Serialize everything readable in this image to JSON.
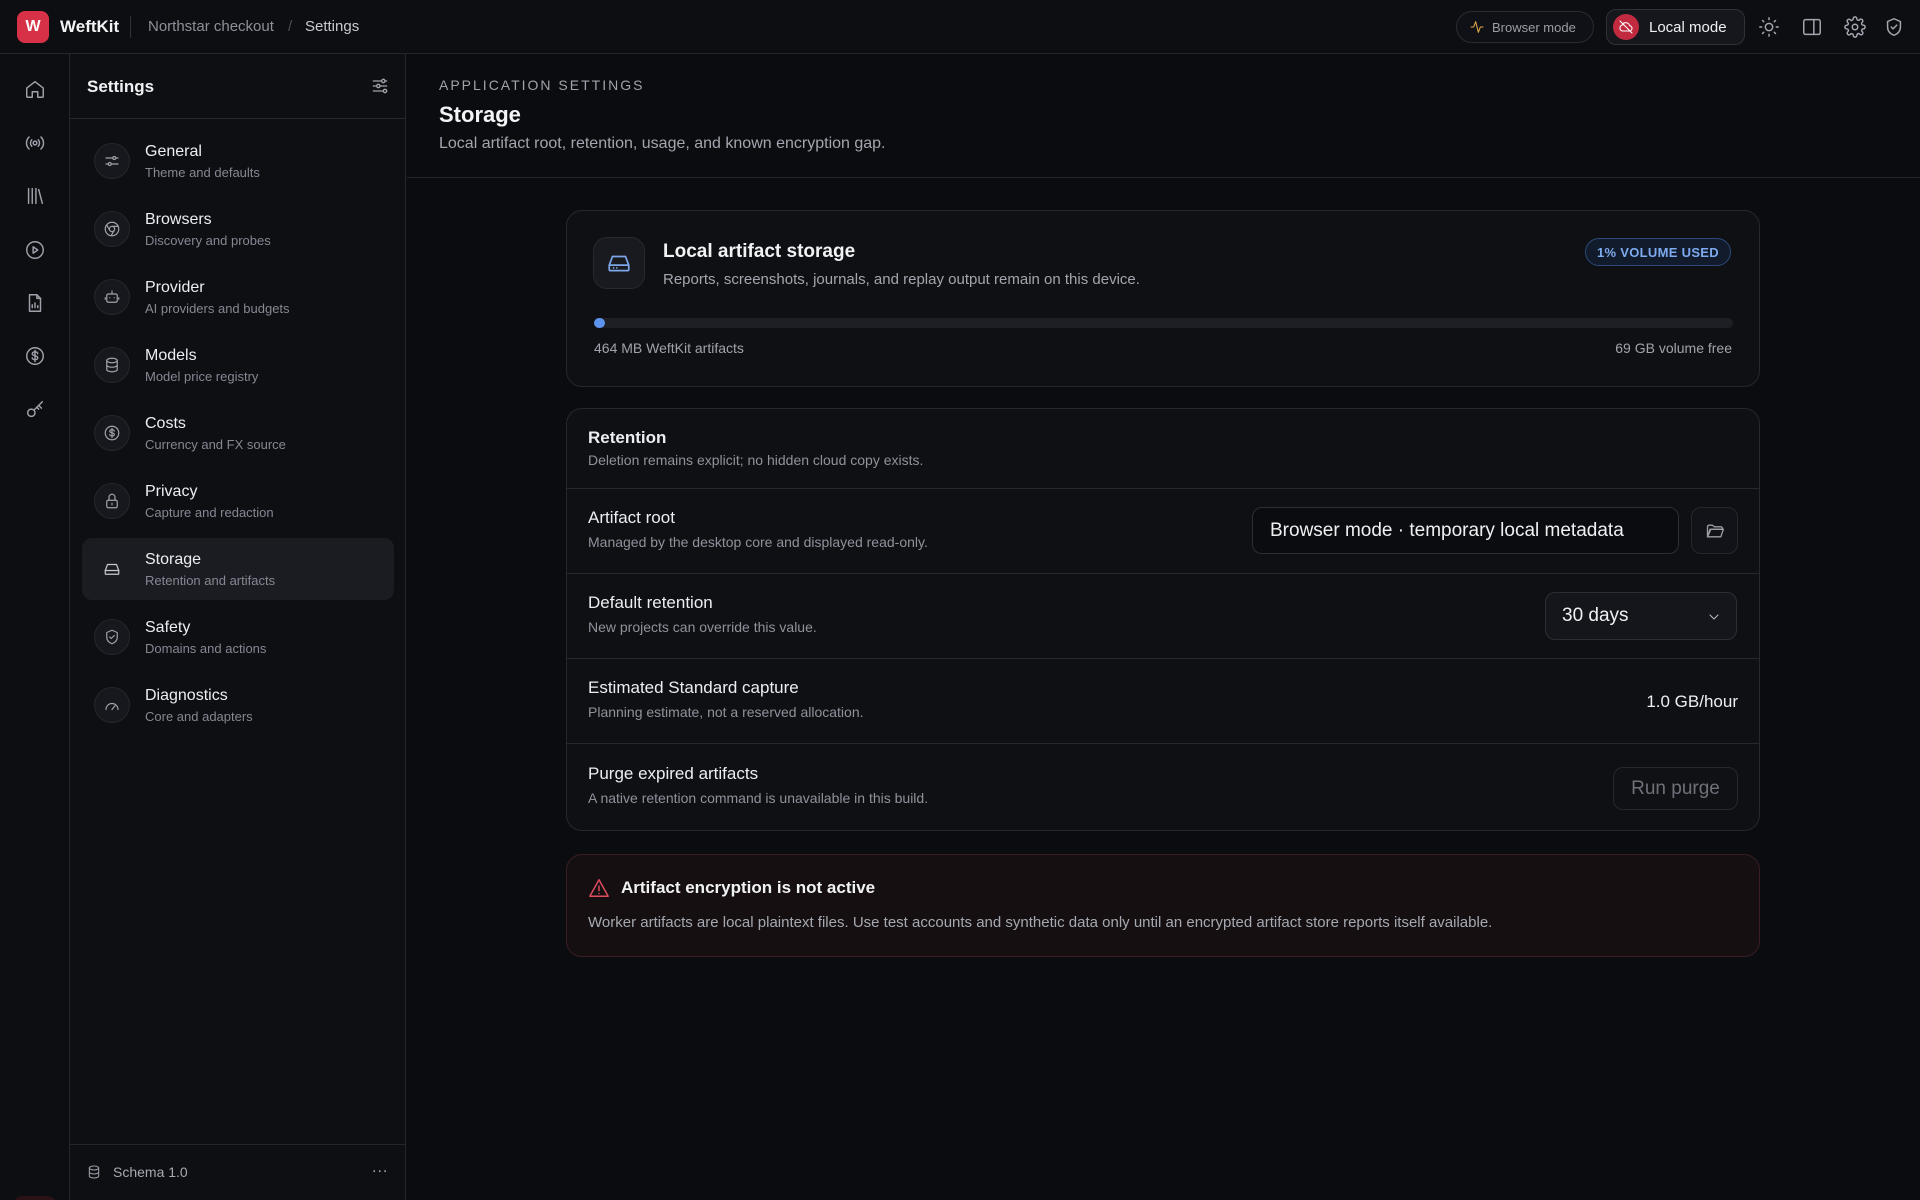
{
  "app": {
    "logo_letter": "W",
    "name": "WeftKit",
    "breadcrumb": [
      "Northstar checkout",
      "Settings"
    ],
    "breadcrumb_separator": "/"
  },
  "topbar": {
    "browser_mode_label": "Browser mode",
    "local_mode_label": "Local mode",
    "icons": [
      "pulse-icon",
      "cloud-off-icon",
      "sun-icon",
      "panel-icon",
      "gear-icon",
      "shield-check-icon"
    ]
  },
  "rail": {
    "icons": [
      "home-icon",
      "broadcast-icon",
      "library-icon",
      "play-icon",
      "report-icon",
      "dollar-icon",
      "key-icon",
      "gear-icon"
    ]
  },
  "sidebar": {
    "title": "Settings",
    "items": [
      {
        "label": "General",
        "sub": "Theme and defaults",
        "icon": "sliders-icon"
      },
      {
        "label": "Browsers",
        "sub": "Discovery and probes",
        "icon": "browser-icon"
      },
      {
        "label": "Provider",
        "sub": "AI providers and budgets",
        "icon": "robot-icon"
      },
      {
        "label": "Models",
        "sub": "Model price registry",
        "icon": "database-icon"
      },
      {
        "label": "Costs",
        "sub": "Currency and FX source",
        "icon": "dollar-icon"
      },
      {
        "label": "Privacy",
        "sub": "Capture and redaction",
        "icon": "lock-icon"
      },
      {
        "label": "Storage",
        "sub": "Retention and artifacts",
        "icon": "drive-icon",
        "active": true
      },
      {
        "label": "Safety",
        "sub": "Domains and actions",
        "icon": "shield-check-icon"
      },
      {
        "label": "Diagnostics",
        "sub": "Core and adapters",
        "icon": "gauge-icon"
      }
    ],
    "footer": {
      "schema": "Schema 1.0",
      "more": "..."
    }
  },
  "header": {
    "eyebrow": "APPLICATION SETTINGS",
    "title": "Storage",
    "description": "Local artifact root, retention, usage, and known encryption gap."
  },
  "storage_card": {
    "title": "Local artifact storage",
    "description": "Reports, screenshots, journals, and replay output remain on this device.",
    "badge": "1% VOLUME USED",
    "usage_fraction": 0.01,
    "used_label": "464 MB WeftKit artifacts",
    "free_label": "69 GB volume free",
    "accent": "#5d93ec"
  },
  "retention": {
    "title": "Retention",
    "description": "Deletion remains explicit; no hidden cloud copy exists.",
    "artifact_root": {
      "label": "Artifact root",
      "sub": "Managed by the desktop core and displayed read-only.",
      "value": "Browser mode · temporary local metadata"
    },
    "default_retention": {
      "label": "Default retention",
      "sub": "New projects can override this value.",
      "value": "30 days"
    },
    "estimated_capture": {
      "label": "Estimated Standard capture",
      "sub": "Planning estimate, not a reserved allocation.",
      "value": "1.0 GB/hour"
    },
    "purge": {
      "label": "Purge expired artifacts",
      "sub": "A native retention command is unavailable in this build.",
      "button": "Run purge"
    }
  },
  "alert": {
    "title": "Artifact encryption is not active",
    "body": "Worker artifacts are local plaintext files. Use test accounts and synthetic data only until an encrypted artifact store reports itself available.",
    "color": "#e04c5e"
  }
}
